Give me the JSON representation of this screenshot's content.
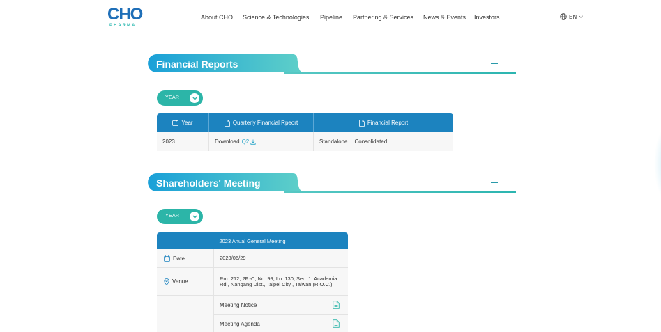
{
  "brand": {
    "name": "CHO",
    "sub": "PHARMA"
  },
  "nav": {
    "items": [
      {
        "label": "About CHO"
      },
      {
        "label": "Science & Technologies"
      },
      {
        "label": "Pipeline"
      },
      {
        "label": "Partnering & Services"
      },
      {
        "label": "News & Events"
      },
      {
        "label": "Investors"
      }
    ],
    "language": "EN"
  },
  "colors": {
    "primary": "#1c83bf",
    "accent": "#2cb5a8",
    "band_start": "#1aa0d8",
    "band_end": "#5fd0c8"
  },
  "financial": {
    "title": "Financial Reports",
    "year_button": "YEAR",
    "headers": {
      "year": "Year",
      "quarterly": "Quarterly Financial Rpeort",
      "report": "Financial Report"
    },
    "row": {
      "year": "2023",
      "download_label": "Download",
      "quarter_link": "Q2",
      "standalone": "Standalone",
      "consolidated": "Consolidated"
    }
  },
  "meeting": {
    "title": "Shareholders' Meeting",
    "year_button": "YEAR",
    "table_title": "2023 Anual General Meeting",
    "date_label": "Date",
    "date_value": "2023/06/29",
    "venue_label": "Venue",
    "venue_value": "Rm. 212, 2F.-C, No. 99, Ln. 130, Sec. 1, Academia Rd., Nangang Dist., Taipei City , Taiwan (R.O.C.)",
    "documents": [
      {
        "label": "Meeting Notice"
      },
      {
        "label": "Meeting Agenda"
      }
    ]
  }
}
